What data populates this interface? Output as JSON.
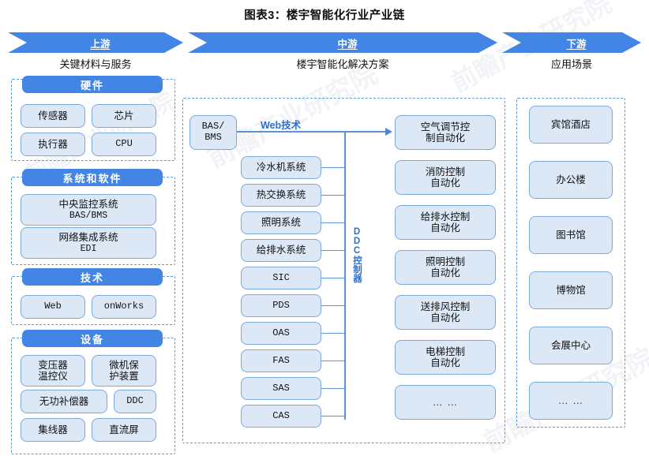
{
  "title": "图表3：楼宇智能化行业产业链",
  "colors": {
    "accent": "#4285e4",
    "box_fill": "#dde8f7",
    "box_border": "#7ba9dd",
    "dashed_border": "#5a9bdc",
    "wire": "#5b93d6",
    "label_text": "#2f6fc9"
  },
  "stages": [
    {
      "name": "上游",
      "desc": "关键材料与服务"
    },
    {
      "name": "中游",
      "desc": "楼宇智能化解决方案"
    },
    {
      "name": "下游",
      "desc": "应用场景"
    }
  ],
  "upstream": {
    "groups": [
      {
        "header": "硬件",
        "items": [
          {
            "line1": "传感器"
          },
          {
            "line1": "芯片"
          },
          {
            "line1": "执行器"
          },
          {
            "line1": "CPU",
            "mono": true
          }
        ]
      },
      {
        "header": "系统和软件",
        "items": [
          {
            "line1": "中央监控系统",
            "line2": "BAS/BMS"
          },
          {
            "line1": "网络集成系统",
            "line2": "EDI"
          }
        ]
      },
      {
        "header": "技术",
        "items": [
          {
            "line1": "Web",
            "mono": true
          },
          {
            "line1": "onWorks",
            "mono": true
          }
        ]
      },
      {
        "header": "设备",
        "items": [
          {
            "line1": "变压器",
            "line2": "温控仪"
          },
          {
            "line1": "微机保",
            "line2": "护装置"
          },
          {
            "line1": "无功补偿器"
          },
          {
            "line1": "DDC",
            "mono": true
          },
          {
            "line1": "集线器"
          },
          {
            "line1": "直流屏"
          }
        ]
      }
    ]
  },
  "midstream": {
    "source": {
      "line1": "BAS/",
      "line2": "BMS"
    },
    "bus_label_top": "Web技术",
    "bus_label_vertical": "DDC控制器",
    "subsystems": [
      "冷水机系统",
      "热交换系统",
      "照明系统",
      "给排水系统",
      "SIC",
      "PDS",
      "OAS",
      "FAS",
      "SAS",
      "CAS"
    ],
    "outputs": [
      {
        "line1": "空气调节控",
        "line2": "制自动化"
      },
      {
        "line1": "消防控制",
        "line2": "自动化"
      },
      {
        "line1": "给排水控制",
        "line2": "自动化"
      },
      {
        "line1": "照明控制",
        "line2": "自动化"
      },
      {
        "line1": "送排风控制",
        "line2": "自动化"
      },
      {
        "line1": "电梯控制",
        "line2": "自动化"
      },
      {
        "line1": "… …",
        "dots": true
      }
    ]
  },
  "downstream": {
    "items": [
      {
        "line1": "宾馆酒店"
      },
      {
        "line1": "办公楼"
      },
      {
        "line1": "图书馆"
      },
      {
        "line1": "博物馆"
      },
      {
        "line1": "会展中心"
      },
      {
        "line1": "… …",
        "dots": true
      }
    ]
  },
  "watermarks": [
    "前瞻产业研究院",
    "前瞻产业研究院",
    "前瞻产业研究院",
    "前瞻产业研究院"
  ]
}
